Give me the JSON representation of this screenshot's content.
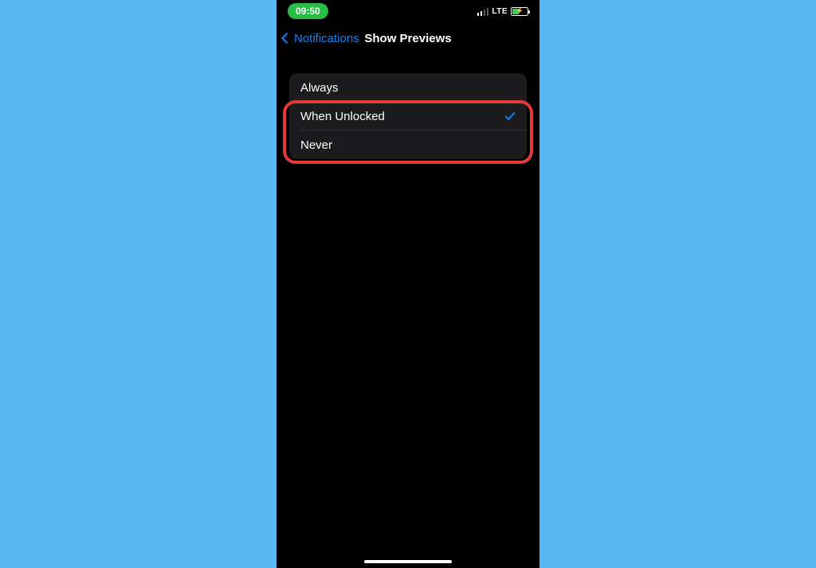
{
  "status": {
    "time": "09:50",
    "network": "LTE"
  },
  "nav": {
    "back_label": "Notifications",
    "title": "Show Previews"
  },
  "options": {
    "items": [
      {
        "label": "Always",
        "selected": false
      },
      {
        "label": "When Unlocked",
        "selected": true
      },
      {
        "label": "Never",
        "selected": false
      }
    ]
  }
}
